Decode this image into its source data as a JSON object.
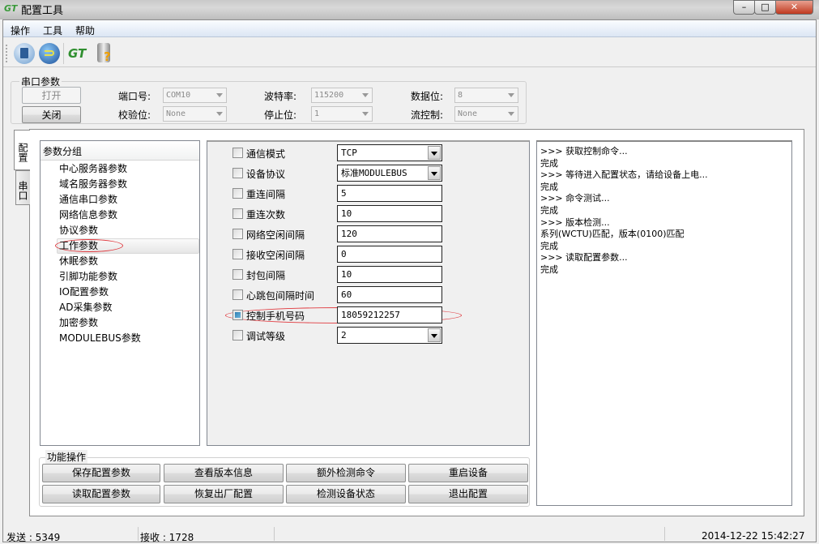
{
  "window": {
    "title": "配置工具",
    "logo": "GT",
    "controls": [
      "minimize",
      "maximize",
      "close"
    ]
  },
  "menu": [
    "操作",
    "工具",
    "帮助"
  ],
  "toolbar": [
    {
      "icon": "trash-icon"
    },
    {
      "icon": "undo-icon"
    },
    {
      "icon": "gt-logo-icon"
    },
    {
      "icon": "database-help-icon"
    }
  ],
  "serial": {
    "group_label": "串口参数",
    "open_label": "打开",
    "close_label": "关闭",
    "port_label": "端口号:",
    "port_value": "COM10",
    "baud_label": "波特率:",
    "baud_value": "115200",
    "databits_label": "数据位:",
    "databits_value": "8",
    "parity_label": "校验位:",
    "parity_value": "None",
    "stopbits_label": "停止位:",
    "stopbits_value": "1",
    "flow_label": "流控制:",
    "flow_value": "None"
  },
  "side_tabs": [
    "配置",
    "串口"
  ],
  "param_groups": {
    "header": "参数分组",
    "items": [
      "中心服务器参数",
      "域名服务器参数",
      "通信串口参数",
      "网络信息参数",
      "协议参数",
      "工作参数",
      "休眠参数",
      "引脚功能参数",
      "IO配置参数",
      "AD采集参数",
      "加密参数",
      "MODULEBUS参数"
    ],
    "selected": "工作参数"
  },
  "params": [
    {
      "label": "通信模式",
      "value": "TCP",
      "type": "select",
      "checked": false
    },
    {
      "label": "设备协议",
      "value": "标准MODULEBUS",
      "type": "select",
      "checked": false
    },
    {
      "label": "重连间隔",
      "value": "5",
      "type": "text",
      "checked": false
    },
    {
      "label": "重连次数",
      "value": "10",
      "type": "text",
      "checked": false
    },
    {
      "label": "网络空闲间隔",
      "value": "120",
      "type": "text",
      "checked": false
    },
    {
      "label": "接收空闲间隔",
      "value": "0",
      "type": "text",
      "checked": false
    },
    {
      "label": "封包间隔",
      "value": "10",
      "type": "text",
      "checked": false
    },
    {
      "label": "心跳包间隔时间",
      "value": "60",
      "type": "text",
      "checked": false
    },
    {
      "label": "控制手机号码",
      "value": "18059212257",
      "type": "text",
      "checked": true
    },
    {
      "label": "调试等级",
      "value": "2",
      "type": "select",
      "checked": false
    }
  ],
  "log": [
    ">>> 获取控制命令...",
    "完成",
    ">>> 等待进入配置状态，请给设备上电...",
    "完成",
    ">>> 命令测试...",
    "完成",
    ">>> 版本检测...",
    "系列(WCTU)匹配，版本(0100)匹配",
    "完成",
    ">>> 读取配置参数...",
    "完成"
  ],
  "functions": {
    "group_label": "功能操作",
    "buttons": [
      "保存配置参数",
      "查看版本信息",
      "额外检测命令",
      "重启设备",
      "读取配置参数",
      "恢复出厂配置",
      "检测设备状态",
      "退出配置"
    ]
  },
  "status": {
    "sent": "发送 : 5349",
    "received": "接收 : 1728",
    "datetime": "2014-12-22 15:42:27"
  },
  "colors": {
    "highlight": "#e0393e",
    "menubar": "#dce6f4"
  }
}
